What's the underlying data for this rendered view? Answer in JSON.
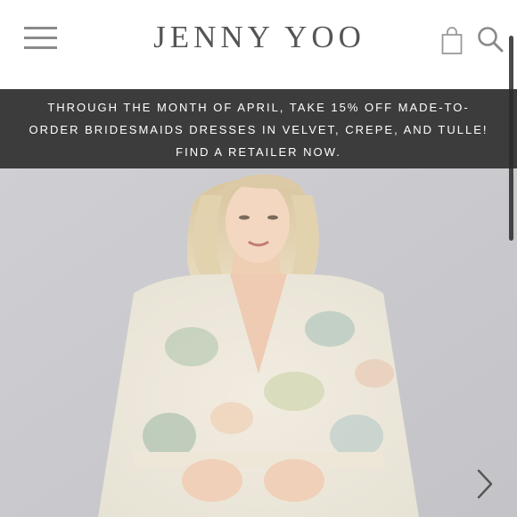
{
  "header": {
    "logo": "JENNY YOO",
    "menu_icon": "hamburger-menu-icon",
    "bag_icon": "shopping-bag-icon",
    "search_icon": "search-icon"
  },
  "promo_banner": {
    "line1": "THROUGH THE MONTH OF APRIL, TAKE 15% OFF MADE-TO-",
    "line2": "ORDER BRIDESMAIDS DRESSES IN VELVET, CREPE, AND TULLE!",
    "line3": "FIND A RETAILER NOW.",
    "background": "#3c3c3c",
    "text_color": "#ffffff"
  },
  "hero": {
    "next_icon": "chevron-right-icon"
  }
}
